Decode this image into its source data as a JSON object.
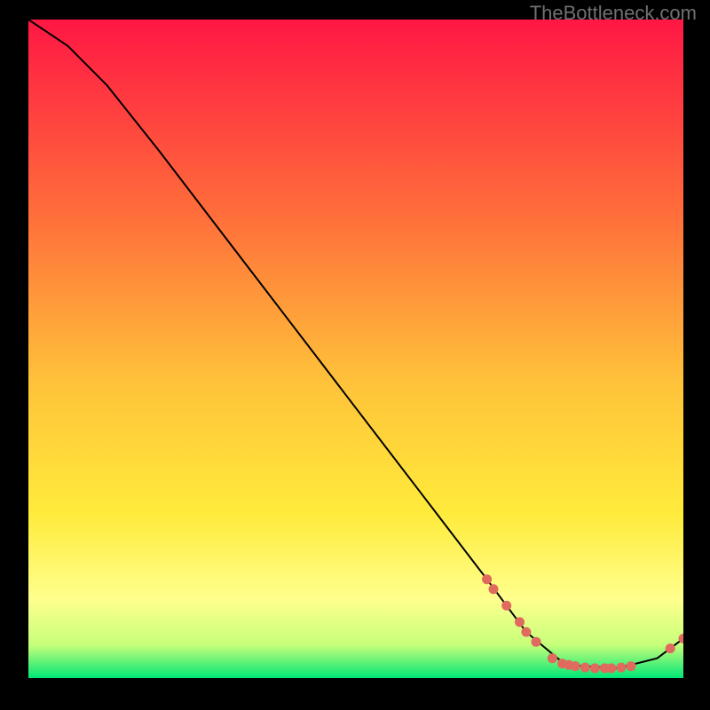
{
  "watermark": "TheBottleneck.com",
  "chart_data": {
    "type": "line",
    "title": "",
    "xlabel": "",
    "ylabel": "",
    "xlim": [
      0,
      100
    ],
    "ylim": [
      0,
      100
    ],
    "grid": false,
    "background_gradient": [
      "#ff1744",
      "#ff9800",
      "#ffeb3b",
      "#ffff8d",
      "#00e676"
    ],
    "curve": [
      {
        "x": 0,
        "y": 100
      },
      {
        "x": 6,
        "y": 96
      },
      {
        "x": 12,
        "y": 90
      },
      {
        "x": 20,
        "y": 80
      },
      {
        "x": 30,
        "y": 67
      },
      {
        "x": 40,
        "y": 54
      },
      {
        "x": 50,
        "y": 41
      },
      {
        "x": 60,
        "y": 28
      },
      {
        "x": 70,
        "y": 15
      },
      {
        "x": 76,
        "y": 7
      },
      {
        "x": 82,
        "y": 2
      },
      {
        "x": 90,
        "y": 1.5
      },
      {
        "x": 96,
        "y": 3
      },
      {
        "x": 100,
        "y": 6
      }
    ],
    "markers": [
      {
        "x": 70,
        "y": 15
      },
      {
        "x": 71,
        "y": 13.5
      },
      {
        "x": 73,
        "y": 11
      },
      {
        "x": 75,
        "y": 8.5
      },
      {
        "x": 76,
        "y": 7
      },
      {
        "x": 77.5,
        "y": 5.5
      },
      {
        "x": 80,
        "y": 3
      },
      {
        "x": 81.5,
        "y": 2.2
      },
      {
        "x": 82.5,
        "y": 2
      },
      {
        "x": 83.5,
        "y": 1.8
      },
      {
        "x": 85,
        "y": 1.6
      },
      {
        "x": 86.5,
        "y": 1.5
      },
      {
        "x": 88,
        "y": 1.5
      },
      {
        "x": 89,
        "y": 1.5
      },
      {
        "x": 90.5,
        "y": 1.6
      },
      {
        "x": 92,
        "y": 1.8
      },
      {
        "x": 98,
        "y": 4.5
      },
      {
        "x": 100,
        "y": 6
      }
    ],
    "marker_color": "#e06a5e",
    "line_color": "#000000"
  }
}
